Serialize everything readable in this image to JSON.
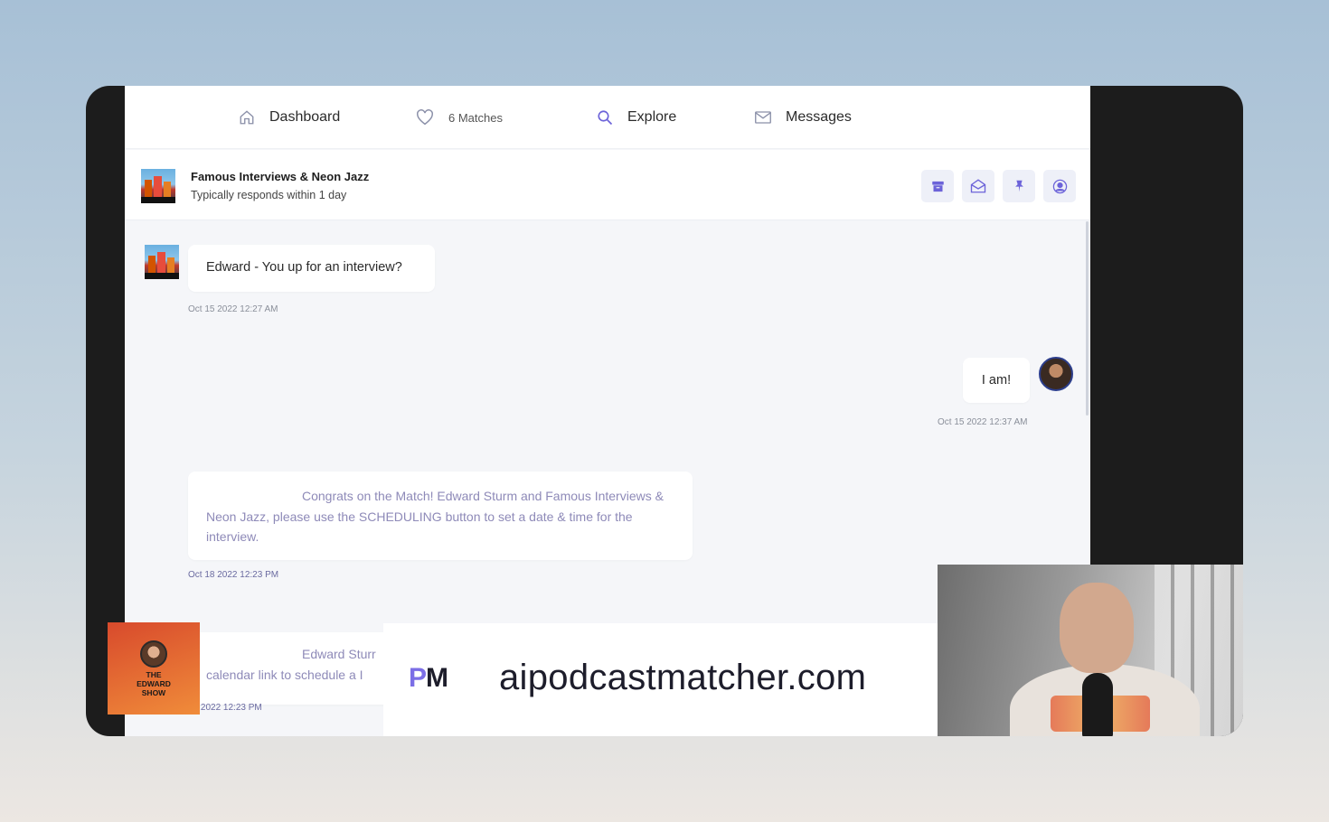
{
  "nav": {
    "dashboard": "Dashboard",
    "matches": "6 Matches",
    "explore": "Explore",
    "messages": "Messages"
  },
  "header": {
    "title": "Famous Interviews & Neon Jazz",
    "subtitle": "Typically responds within 1 day"
  },
  "messages": [
    {
      "text": "Edward - You up for an interview?",
      "timestamp": "Oct 15 2022  12:27 AM"
    },
    {
      "text": "I am!",
      "timestamp": "Oct 15 2022  12:37 AM"
    },
    {
      "text": "Congrats on the Match! Edward Sturm and Famous Interviews & Neon Jazz, please use the SCHEDULING button to set a date & time for the interview.",
      "timestamp": "Oct 18 2022  12:23 PM"
    },
    {
      "line1": "Edward Sturr",
      "line2": "calendar link to schedule a I",
      "timestamp": "18 2022  12:23 PM"
    }
  ],
  "promo": {
    "logo_p": "P",
    "logo_m": "M",
    "url": "aipodcastmatcher.com"
  },
  "show": {
    "line1": "THE",
    "line2": "EDWARD",
    "line3": "SHOW"
  },
  "icons": {
    "nav": [
      "home-icon",
      "heart-icon",
      "search-icon",
      "envelope-icon"
    ],
    "actions": [
      "archive-icon",
      "mail-open-icon",
      "pin-icon",
      "user-circle-icon"
    ]
  },
  "colors": {
    "accent": "#6c63d9",
    "action_bg": "#eef0f8",
    "system_text": "#8e8ab8"
  }
}
